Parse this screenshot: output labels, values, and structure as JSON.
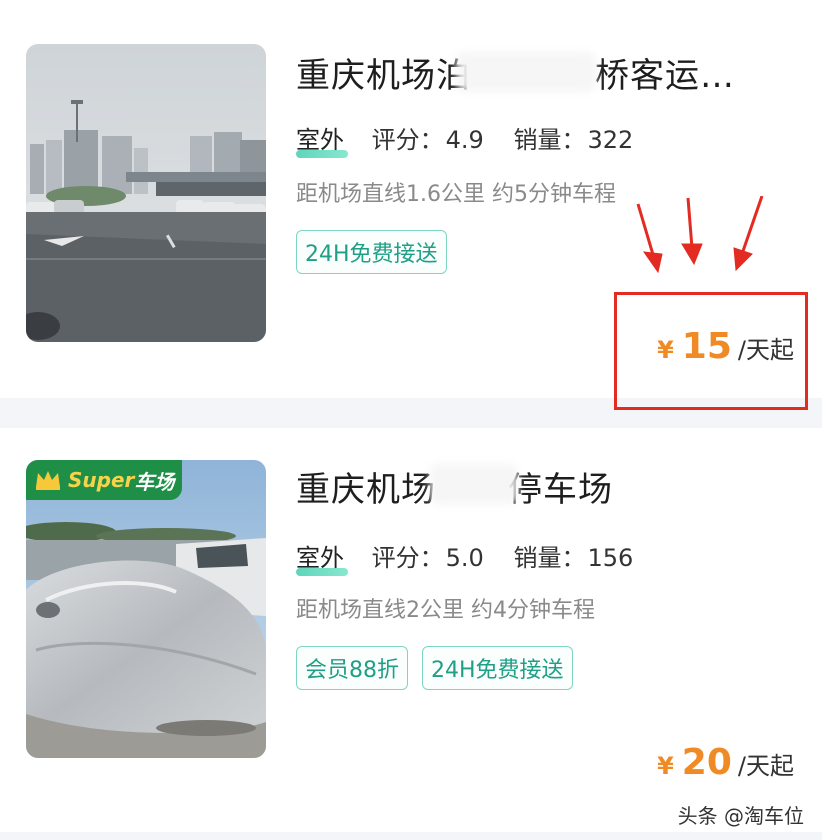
{
  "listings": [
    {
      "title": "重庆机场泊",
      "title_tail": "桥客运…",
      "tag": "室外",
      "rating_label": "评分：",
      "rating": "4.9",
      "sales_label": "销量：",
      "sales": "322",
      "distance": "距机场直线1.6公里 约5分钟车程",
      "badges": [
        "24H免费接送"
      ],
      "price_currency": "¥",
      "price": "15",
      "price_unit": "/天起"
    },
    {
      "title": "重庆机场",
      "title_tail": "停车场",
      "tag": "室外",
      "rating_label": "评分：",
      "rating": "5.0",
      "sales_label": "销量：",
      "sales": "156",
      "distance": "距机场直线2公里 约4分钟车程",
      "badges": [
        "会员88折",
        "24H免费接送"
      ],
      "price_currency": "¥",
      "price": "20",
      "price_unit": "/天起",
      "image_badge": {
        "brand": "Super",
        "suffix": "车场"
      }
    }
  ],
  "watermark": "头条 @淘车位",
  "colors": {
    "accent_orange": "#f08a24",
    "badge_green": "#1f9f86",
    "highlight_red": "#e32b22"
  }
}
